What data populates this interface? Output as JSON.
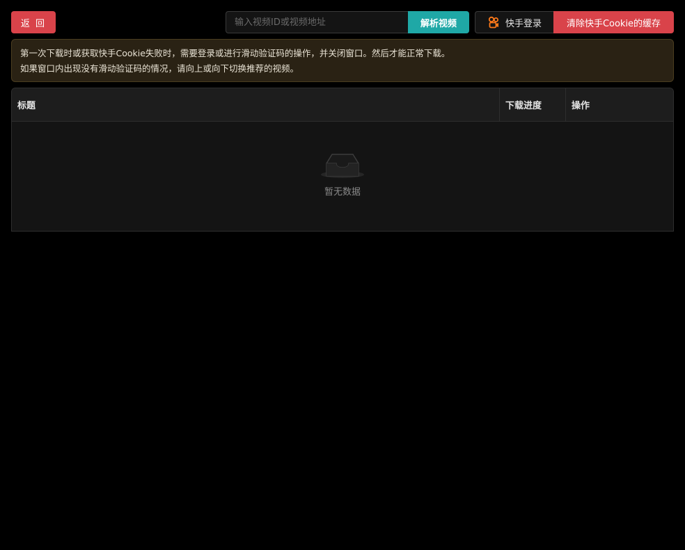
{
  "toolbar": {
    "back_label": "返 回",
    "search_placeholder": "输入视频ID或视频地址",
    "search_value": "",
    "parse_label": "解析视频",
    "login_label": "快手登录",
    "login_icon": "kuaishou-logo-icon",
    "clear_cookie_label": "清除快手Cookie的缓存"
  },
  "notice": {
    "line1": "第一次下载时或获取快手Cookie失败时，需要登录或进行滑动验证码的操作，并关闭窗口。然后才能正常下载。",
    "line2": "如果窗口内出现没有滑动验证码的情况，请向上或向下切换推荐的视频。"
  },
  "table": {
    "columns": [
      "标题",
      "下载进度",
      "操作"
    ],
    "rows": [],
    "empty_text": "暂无数据",
    "empty_icon": "empty-inbox-icon"
  },
  "colors": {
    "danger": "#d9434a",
    "primary": "#1fa8a6",
    "kuaishou": "#ff7a1a",
    "notice_bg": "#2a2214"
  }
}
